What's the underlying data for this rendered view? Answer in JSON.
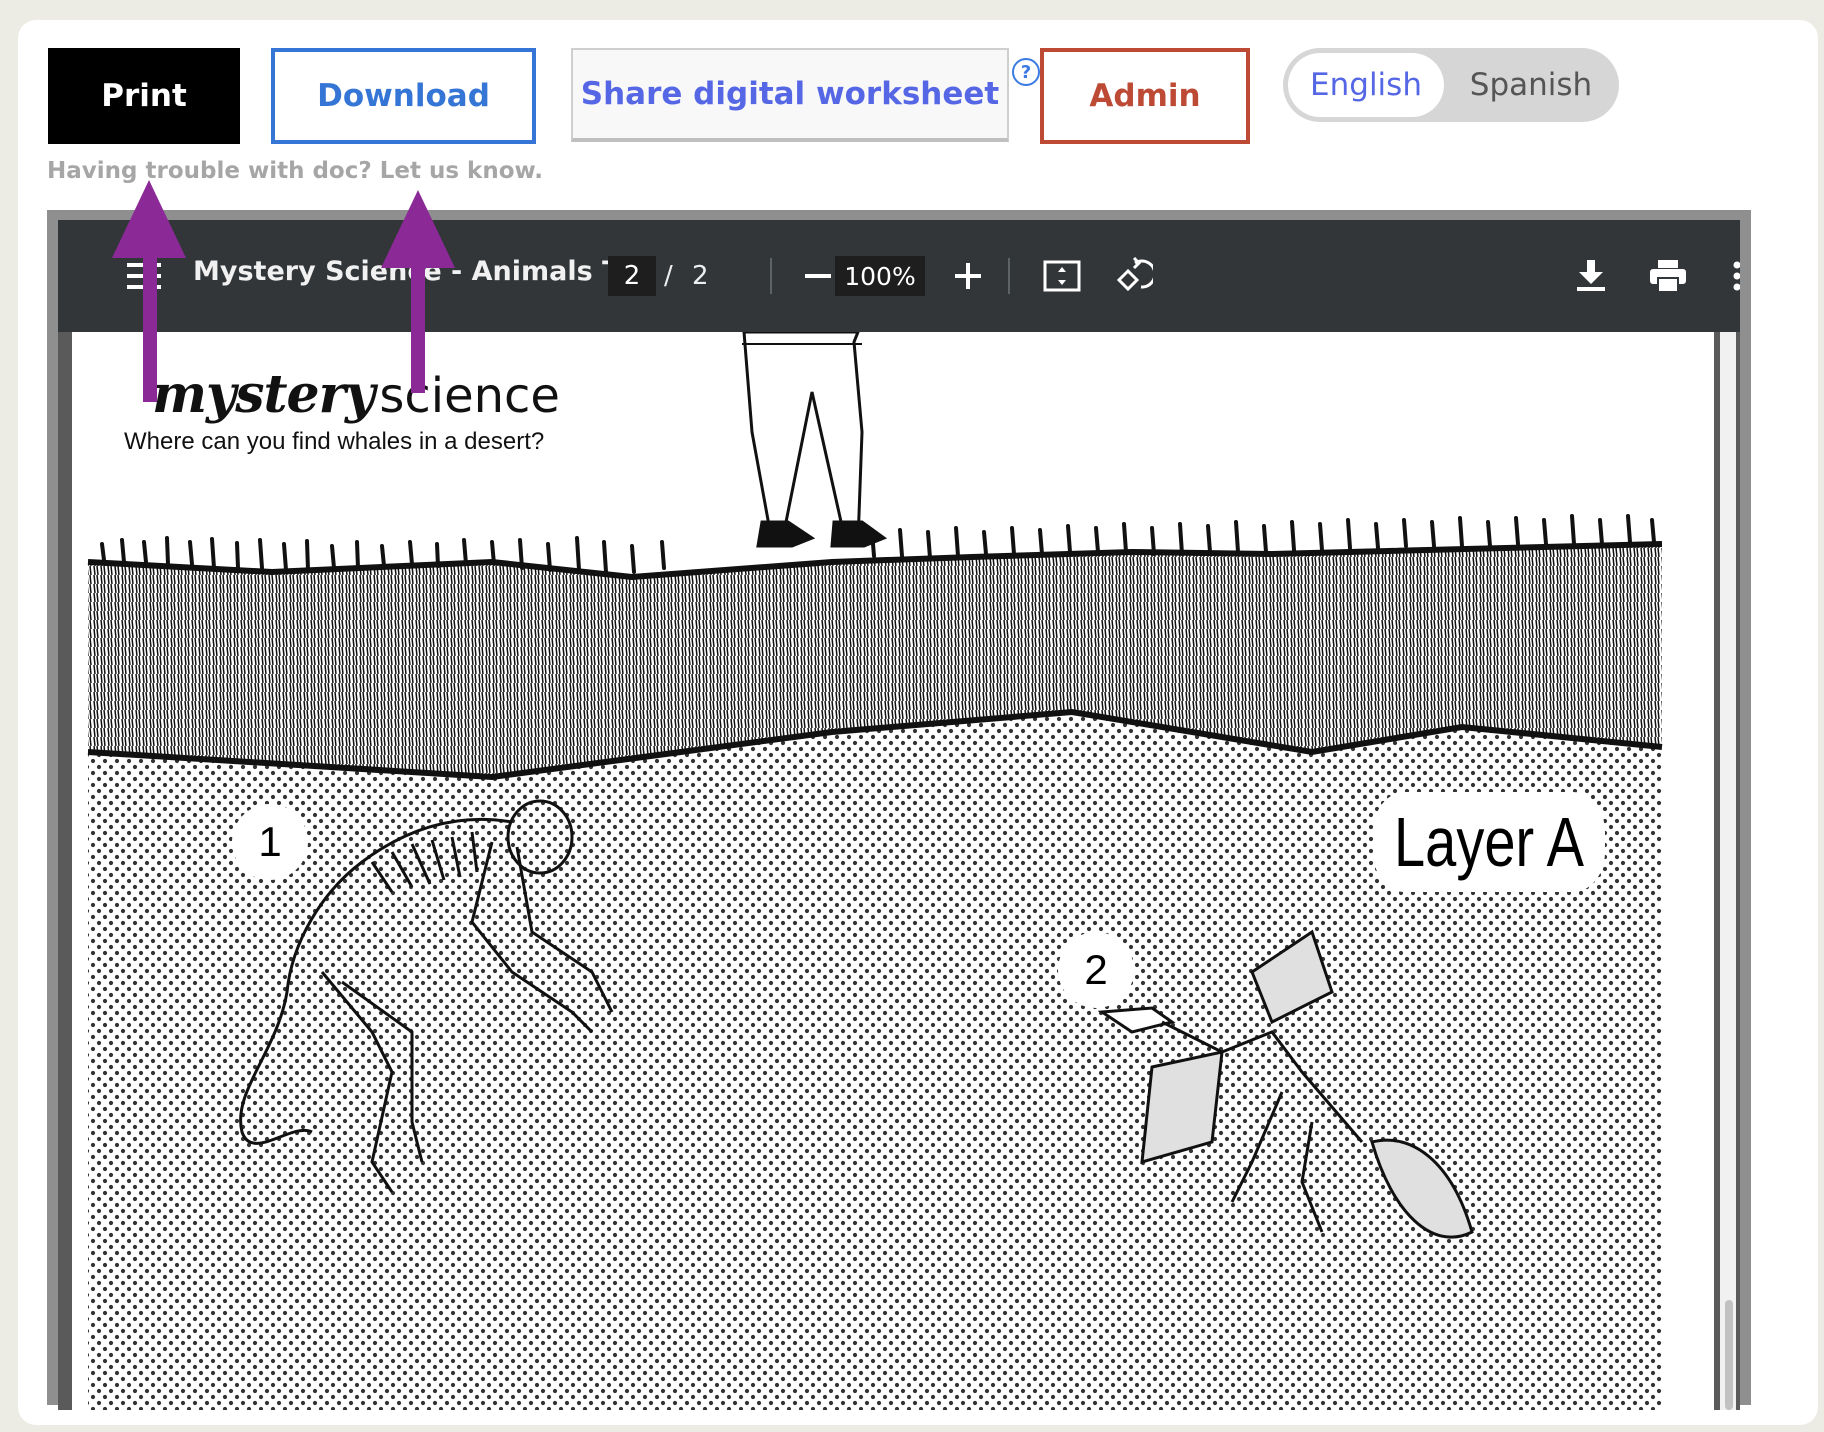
{
  "toolbar": {
    "print_label": "Print",
    "download_label": "Download",
    "share_label": "Share digital worksheet",
    "help_label": "?",
    "admin_label": "Admin",
    "languages": [
      "English",
      "Spanish"
    ],
    "selected_language": "English",
    "trouble_text": "Having trouble with doc? Let us know."
  },
  "colors": {
    "download": "#3575d5",
    "share_text": "#5667e6",
    "admin": "#bd4a35",
    "annotation_arrow": "#8b2a97"
  },
  "pdf_viewer": {
    "title": "Mystery Science - Animals T...",
    "current_page": "2",
    "page_separator": "/",
    "total_pages": "2",
    "zoom": "100%",
    "icons": [
      "menu-icon",
      "zoom-out-icon",
      "zoom-in-icon",
      "fit-page-icon",
      "rotate-icon",
      "download-icon",
      "print-icon",
      "more-options-icon"
    ]
  },
  "document": {
    "logo_bold": "mystery",
    "logo_light": "science",
    "subtitle": "Where can you find whales in a desert?",
    "layer_label": "Layer A",
    "markers": [
      "1",
      "2"
    ]
  }
}
